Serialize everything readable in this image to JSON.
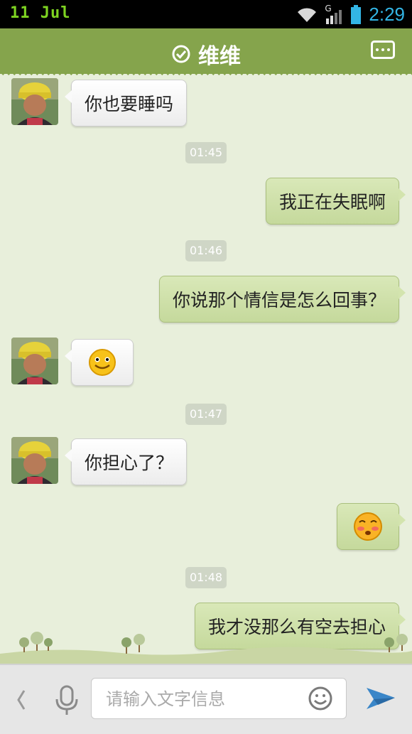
{
  "status_bar": {
    "left_text": "11  Jul",
    "time": "2:29",
    "network": "G"
  },
  "header": {
    "title": "维维"
  },
  "input": {
    "placeholder": "请输入文字信息"
  },
  "messages": [
    {
      "type": "in",
      "text": "你也要睡吗"
    },
    {
      "type": "time",
      "text": "01:45"
    },
    {
      "type": "out",
      "text": "我正在失眠啊"
    },
    {
      "type": "time",
      "text": "01:46"
    },
    {
      "type": "out",
      "text": "你说那个情信是怎么回事？"
    },
    {
      "type": "in",
      "emoji": "smile"
    },
    {
      "type": "time",
      "text": "01:47"
    },
    {
      "type": "in",
      "text": "你担心了？"
    },
    {
      "type": "out",
      "emoji": "blush"
    },
    {
      "type": "time",
      "text": "01:48"
    },
    {
      "type": "out",
      "text": "我才没那么有空去担心"
    }
  ],
  "colors": {
    "header_green": "#85a44c",
    "chat_bg": "#e8efdb",
    "status_time": "#33b5e5"
  },
  "icons": [
    "check-circle-icon",
    "more-menu-icon",
    "back-chevron-icon",
    "microphone-icon",
    "emoji-face-icon",
    "send-icon"
  ]
}
